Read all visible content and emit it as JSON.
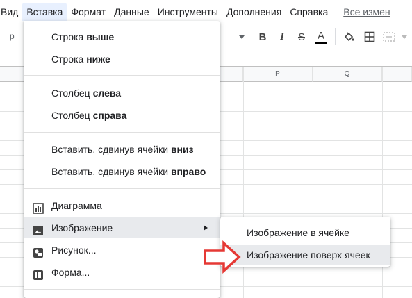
{
  "menubar": {
    "items": [
      "Вид",
      "Вставка",
      "Формат",
      "Данные",
      "Инструменты",
      "Дополнения",
      "Справка"
    ],
    "last_edit": "Все измен",
    "active_index": 1
  },
  "toolbar": {
    "font_fragment": "р",
    "bold": "B",
    "italic": "I",
    "strike": "S",
    "text_color": "A",
    "text_color_value": "#000000"
  },
  "grid": {
    "columns": [
      "P",
      "Q"
    ]
  },
  "insert_menu": {
    "row_above": {
      "prefix": "Строка ",
      "bold": "выше"
    },
    "row_below": {
      "prefix": "Строка ",
      "bold": "ниже"
    },
    "col_left": {
      "prefix": "Столбец ",
      "bold": "слева"
    },
    "col_right": {
      "prefix": "Столбец ",
      "bold": "справа"
    },
    "shift_down": {
      "prefix": "Вставить, сдвинув ячейки ",
      "bold": "вниз"
    },
    "shift_right": {
      "prefix": "Вставить, сдвинув ячейки ",
      "bold": "вправо"
    },
    "chart": "Диаграмма",
    "image": "Изображение",
    "drawing": "Рисунок...",
    "form": "Форма..."
  },
  "image_submenu": {
    "in_cell": "Изображение в ячейке",
    "over_cells": "Изображение поверх ячеек"
  },
  "colors": {
    "menu_active": "#e8f0fe",
    "hover": "#e8eaed",
    "annotation_arrow": "#e53935"
  }
}
